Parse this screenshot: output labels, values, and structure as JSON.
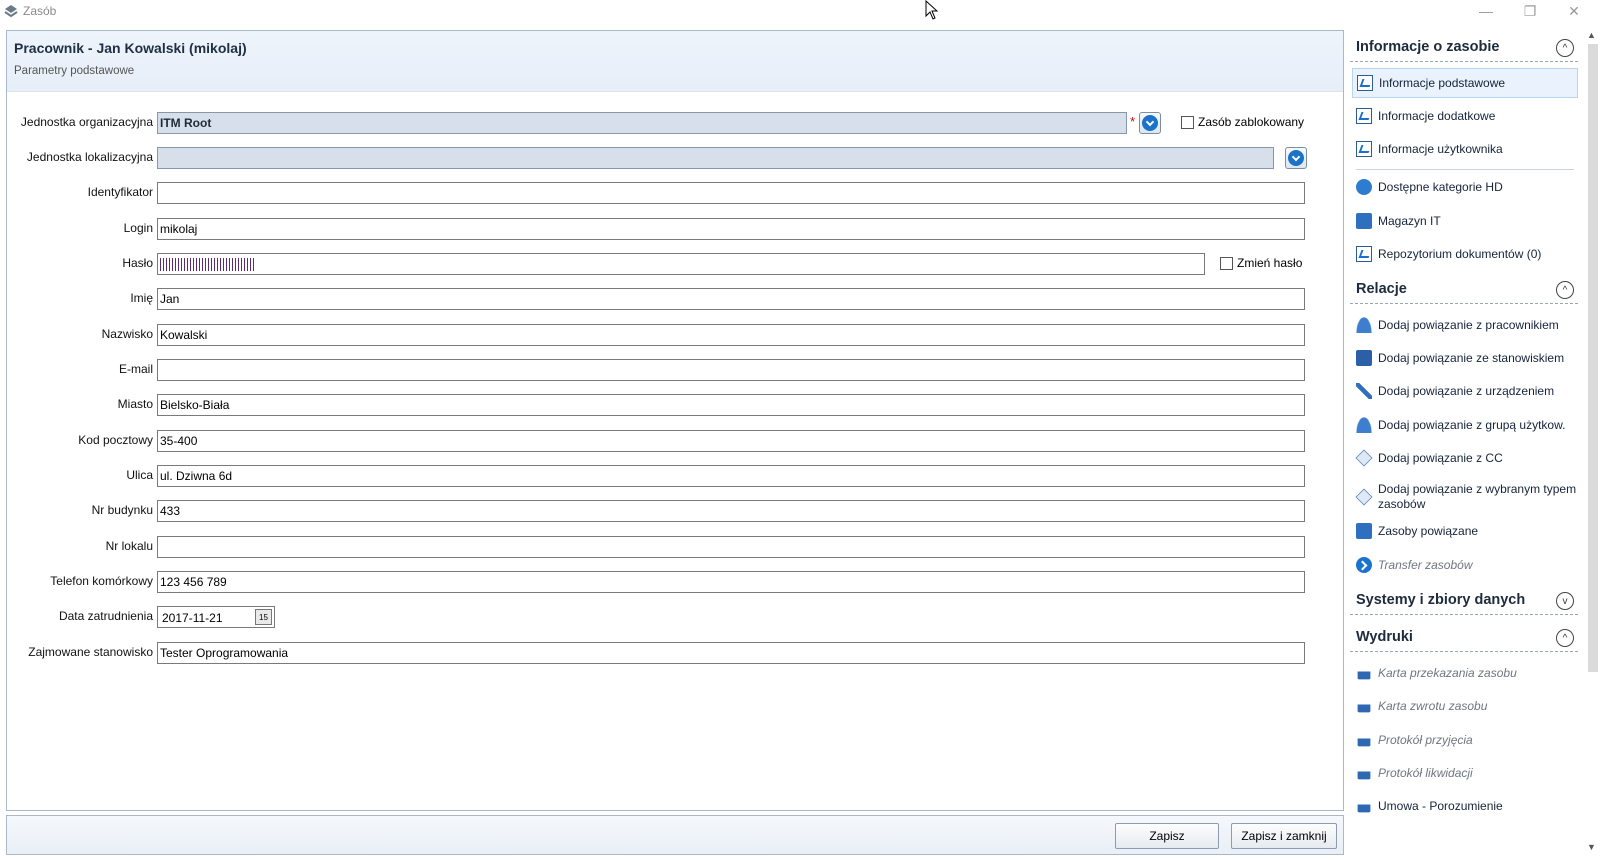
{
  "window": {
    "title": "Zasób",
    "controls": {
      "minimize": "—",
      "restore": "❐",
      "close": "✕"
    }
  },
  "form": {
    "title": "Pracownik - Jan Kowalski (mikolaj)",
    "subtitle": "Parametry podstawowe",
    "fields": {
      "org_unit": {
        "label": "Jednostka organizacyjna",
        "value": "ITM Root"
      },
      "blocked": {
        "label": "Zasób zablokowany"
      },
      "location_unit": {
        "label": "Jednostka lokalizacyjna",
        "value": ""
      },
      "identifier": {
        "label": "Identyfikator",
        "value": ""
      },
      "login": {
        "label": "Login",
        "value": "mikolaj"
      },
      "password": {
        "label": "Hasło"
      },
      "change_password": {
        "label": "Zmień hasło"
      },
      "first_name": {
        "label": "Imię",
        "value": "Jan"
      },
      "last_name": {
        "label": "Nazwisko",
        "value": "Kowalski"
      },
      "email": {
        "label": "E-mail",
        "value": ""
      },
      "city": {
        "label": "Miasto",
        "value": "Bielsko-Biała"
      },
      "postal_code": {
        "label": "Kod pocztowy",
        "value": "35-400"
      },
      "street": {
        "label": "Ulica",
        "value": "ul. Dziwna 6d"
      },
      "building_no": {
        "label": "Nr budynku",
        "value": "433"
      },
      "apartment_no": {
        "label": "Nr lokalu",
        "value": ""
      },
      "mobile": {
        "label": "Telefon komórkowy",
        "value": "123 456 789"
      },
      "hire_date": {
        "label": "Data zatrudnienia",
        "value": "2017-11-21",
        "calendar_glyph": "15"
      },
      "position": {
        "label": "Zajmowane stanowisko",
        "value": "Tester Oprogramowania"
      }
    },
    "required_mark": "*"
  },
  "buttons": {
    "save": "Zapisz",
    "save_close": "Zapisz i zamknij"
  },
  "side": {
    "sections": {
      "info": {
        "title": "Informacje o zasobie",
        "toggle": "^"
      },
      "relations": {
        "title": "Relacje",
        "toggle": "^"
      },
      "systems": {
        "title": "Systemy i zbiory danych",
        "toggle": "v"
      },
      "prints": {
        "title": "Wydruki",
        "toggle": "^"
      }
    },
    "info_items": [
      "Informacje podstawowe",
      "Informacje dodatkowe",
      "Informacje użytkownika",
      "Dostępne kategorie HD",
      "Magazyn IT",
      "Repozytorium dokumentów (0)"
    ],
    "relation_items": [
      "Dodaj powiązanie z pracownikiem",
      "Dodaj powiązanie ze stanowiskiem",
      "Dodaj powiązanie z urządzeniem",
      "Dodaj powiązanie z grupą użytkow.",
      "Dodaj powiązanie z CC",
      "Dodaj powiązanie z wybranym typem zasobów",
      "Zasoby powiązane",
      "Transfer zasobów"
    ],
    "print_items": [
      "Karta przekazania zasobu",
      "Karta zwrotu zasobu",
      "Protokół przyjęcia",
      "Protokół likwidacji",
      "Umowa - Porozumienie"
    ]
  },
  "colors": {
    "accent": "#1a73c9",
    "readonly_bg": "#d6dfea",
    "header_bg": "#eef4fb"
  }
}
